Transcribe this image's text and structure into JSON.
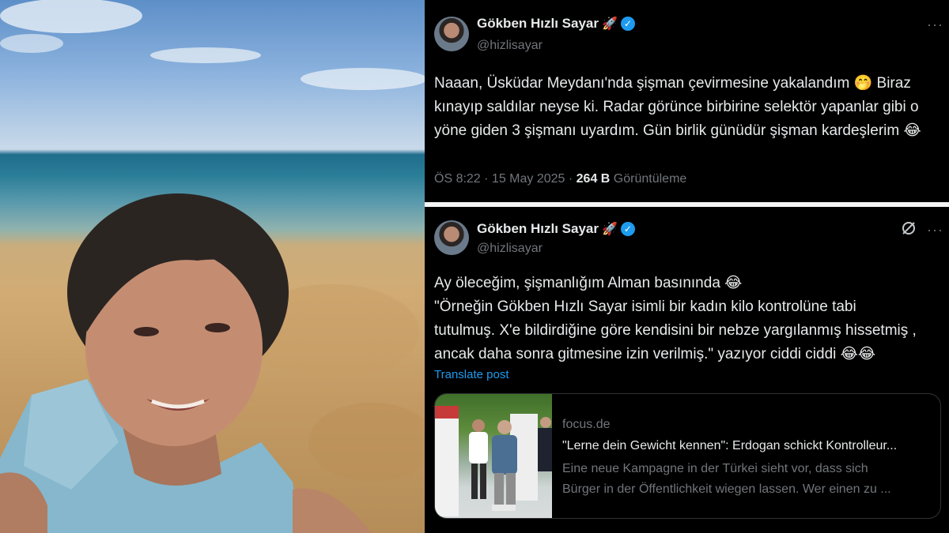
{
  "tweet1": {
    "name": "Gökben Hızlı Sayar",
    "name_emoji": "🚀",
    "handle": "@hizlisayar",
    "more": "···",
    "lines": [
      "Naaan, Üsküdar Meydanı'nda şişman çevirmesine yakalandım 🤭 Biraz",
      "kınayıp saldılar neyse ki. Radar görünce birbirine selektör yapanlar gibi o",
      "yöne giden 3 şişmanı uyardım. Gün birlik günüdür şişman kardeşlerim 😂"
    ],
    "time": "ÖS 8:22 · 15 May 2025 · ",
    "views_count": "264 B",
    "views_label": " Görüntüleme"
  },
  "tweet2": {
    "name": "Gökben Hızlı Sayar",
    "name_emoji": "🚀",
    "handle": "@hizlisayar",
    "more": "···",
    "grok_icon": "grok-icon",
    "lines": [
      "Ay öleceğim, şişmanlığım Alman basınında 😂",
      "\"Örneğin Gökben Hızlı Sayar isimli bir kadın kilo kontrolüne tabi",
      "tutulmuş. X'e bildirdiğine göre kendisini bir nebze yargılanmış hissetmiş ,",
      "ancak daha sonra gitmesine izin verilmiş.\" yazıyor ciddi ciddi 😂😂"
    ],
    "translate": "Translate post",
    "card": {
      "domain": "focus.de",
      "title": "\"Lerne dein Gewicht kennen\": Erdogan schickt Kontrolleur...",
      "desc_lines": [
        "Eine neue Kampagne in der Türkei sieht vor, dass sich",
        "Bürger in der Öffentlichkeit wiegen lassen. Wer einen zu ..."
      ]
    }
  },
  "colors": {
    "accent": "#1d9bf0",
    "muted": "#71767b",
    "text": "#e7e9ea"
  }
}
